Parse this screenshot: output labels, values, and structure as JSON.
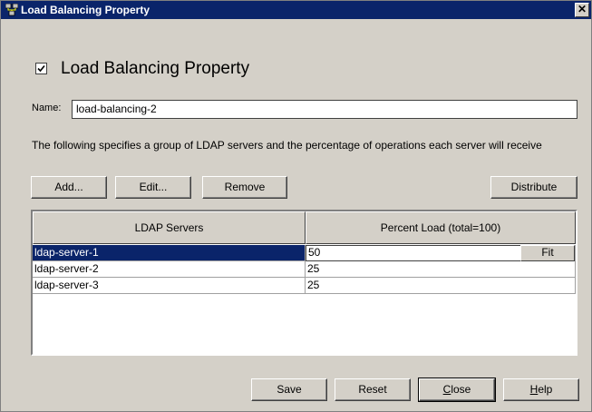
{
  "window": {
    "title": "Load Balancing Property",
    "close_glyph": "✕"
  },
  "heading": {
    "checked": true,
    "text": "Load Balancing Property"
  },
  "name_field": {
    "label": "Name:",
    "value": "load-balancing-2"
  },
  "description": "The following specifies a group of LDAP servers and the percentage of operations each server will receive",
  "toolbar": {
    "add": "Add...",
    "edit": "Edit...",
    "remove": "Remove",
    "distribute": "Distribute"
  },
  "table": {
    "columns": [
      "LDAP Servers",
      "Percent Load (total=100)"
    ],
    "rows": [
      {
        "server": "ldap-server-1",
        "load": "50"
      },
      {
        "server": "ldap-server-2",
        "load": "25"
      },
      {
        "server": "ldap-server-3",
        "load": "25"
      }
    ],
    "fit_label": "Fit"
  },
  "footer": {
    "save": "Save",
    "reset": "Reset",
    "close_first": "C",
    "close_rest": "lose",
    "help_first": "H",
    "help_rest": "elp"
  },
  "colors": {
    "titlebar": "#0a246a",
    "selection": "#0a246a",
    "face": "#d4d0c8"
  },
  "icons": {
    "title": "network-servers-icon",
    "close": "close-icon",
    "check": "checkmark-icon"
  }
}
